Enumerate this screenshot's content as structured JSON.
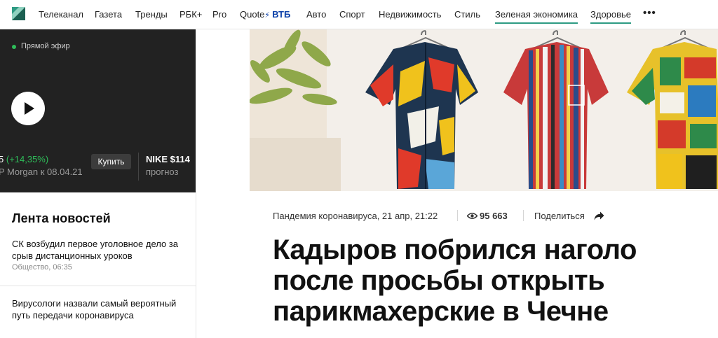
{
  "nav": {
    "items": [
      "Телеканал",
      "Газета",
      "Тренды",
      "РБК+",
      "Pro",
      "Quote",
      "Авто",
      "Спорт",
      "Недвижимость",
      "Стиль",
      "Зеленая экономика",
      "Здоровье"
    ],
    "quote_partner": "ВТБ",
    "more_icon": "more-dots-icon",
    "logo_icon": "rbc-logo-icon",
    "accent_color": "#2e9b83"
  },
  "player": {
    "live_label": "Прямой эфир",
    "play_icon": "play-icon"
  },
  "ticker": {
    "item1_value": "5",
    "item1_change": "(+14,35%)",
    "item1_sub": "P Morgan к 08.04.21",
    "buy_label": "Купить",
    "item2_name": "NIKE $114",
    "item2_sub": "прогноз",
    "positive_color": "#2ebd59"
  },
  "feed": {
    "title": "Лента новостей",
    "items": [
      {
        "title": "СК возбудил первое уголовное дело за срыв дистанционных уроков",
        "meta": "Общество, 06:35"
      },
      {
        "title": "Вирусологи назвали самый вероятный путь передачи коронавируса",
        "meta": ""
      }
    ]
  },
  "article": {
    "meta": "Пандемия коронавируса, 21 апр, 21:22",
    "views": "95 663",
    "share_label": "Поделиться",
    "headline": "Кадыров побрился наголо после просьбы открыть парикмахерские в Чечне"
  }
}
